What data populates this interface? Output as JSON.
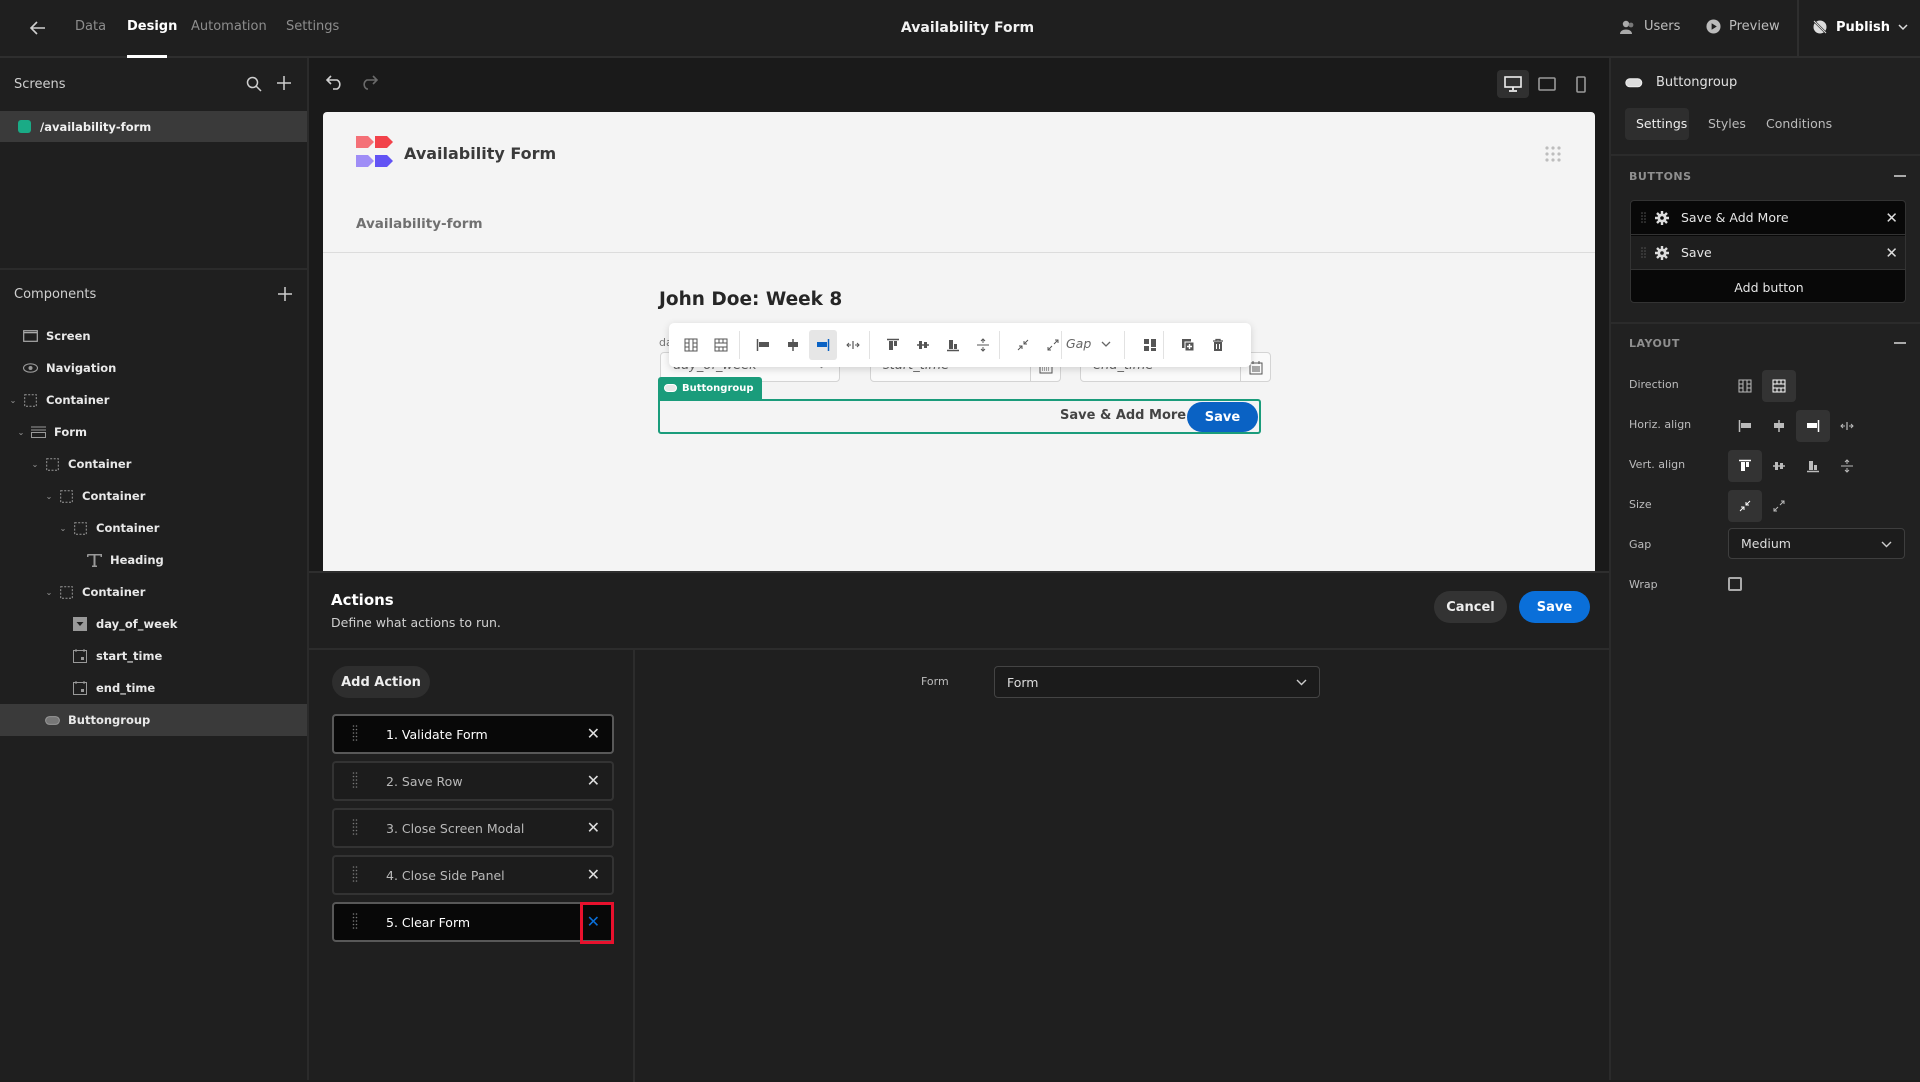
{
  "topbar": {
    "back_icon": "arrow-left-icon",
    "tabs": [
      {
        "label": "Data",
        "active": false
      },
      {
        "label": "Design",
        "active": true
      },
      {
        "label": "Automation",
        "active": false
      },
      {
        "label": "Settings",
        "active": false
      }
    ],
    "app_title": "Availability Form",
    "users_label": "Users",
    "preview_label": "Preview",
    "publish_label": "Publish"
  },
  "sidebar": {
    "screens_title": "Screens",
    "screens": [
      {
        "route": "/availability-form",
        "color": "#1aab86",
        "selected": true
      }
    ],
    "components_title": "Components",
    "tree": [
      {
        "label": "Screen",
        "icon": "screen-icon",
        "depth": 0,
        "expandable": false
      },
      {
        "label": "Navigation",
        "icon": "eye-icon",
        "depth": 0,
        "expandable": false
      },
      {
        "label": "Container",
        "icon": "container-icon",
        "depth": 0,
        "expandable": true
      },
      {
        "label": "Form",
        "icon": "form-icon",
        "depth": 1,
        "expandable": true
      },
      {
        "label": "Container",
        "icon": "container-icon",
        "depth": 2,
        "expandable": true
      },
      {
        "label": "Container",
        "icon": "container-icon",
        "depth": 3,
        "expandable": true
      },
      {
        "label": "Container",
        "icon": "container-icon",
        "depth": 4,
        "expandable": true
      },
      {
        "label": "Heading",
        "icon": "heading-icon",
        "depth": 5,
        "expandable": false
      },
      {
        "label": "Container",
        "icon": "container-icon",
        "depth": 3,
        "expandable": true
      },
      {
        "label": "day_of_week",
        "icon": "dropdown-icon",
        "depth": 4,
        "expandable": false
      },
      {
        "label": "start_time",
        "icon": "calendar-icon",
        "depth": 4,
        "expandable": false
      },
      {
        "label": "end_time",
        "icon": "calendar-icon",
        "depth": 4,
        "expandable": false
      },
      {
        "label": "Buttongroup",
        "icon": "buttongroup-icon",
        "depth": 2,
        "expandable": false,
        "selected": true
      }
    ]
  },
  "canvas": {
    "device_modes": [
      "desktop",
      "tablet",
      "mobile"
    ],
    "active_device": "desktop",
    "preview": {
      "app_name": "Availability Form",
      "nav_link": "Availability-form",
      "heading": "John Doe: Week 8",
      "field_label_partial": "da",
      "fields": [
        {
          "name": "day_of_week",
          "type": "select"
        },
        {
          "name": "start_time",
          "type": "datetime"
        },
        {
          "name": "end_time",
          "type": "datetime"
        }
      ],
      "selected_tag": "Buttongroup",
      "buttons": [
        {
          "label": "Save & Add More",
          "style": "secondary"
        },
        {
          "label": "Save",
          "style": "primary"
        }
      ]
    },
    "toolbar": {
      "gap_label": "Gap"
    }
  },
  "rightpanel": {
    "component_name": "Buttongroup",
    "tabs": [
      {
        "label": "Settings",
        "active": true
      },
      {
        "label": "Styles",
        "active": false
      },
      {
        "label": "Conditions",
        "active": false
      }
    ],
    "buttons_section": {
      "title": "BUTTONS",
      "items": [
        {
          "label": "Save & Add More"
        },
        {
          "label": "Save"
        }
      ],
      "add_label": "Add button"
    },
    "layout_section": {
      "title": "LAYOUT",
      "direction_label": "Direction",
      "direction_value": "column",
      "horiz_label": "Horiz. align",
      "horiz_value": "right",
      "vert_label": "Vert. align",
      "vert_value": "top",
      "size_label": "Size",
      "size_value": "shrink",
      "gap_label": "Gap",
      "gap_value": "Medium",
      "wrap_label": "Wrap",
      "wrap_checked": false
    }
  },
  "actions": {
    "title": "Actions",
    "subtitle": "Define what actions to run.",
    "cancel_label": "Cancel",
    "save_label": "Save",
    "add_action_label": "Add Action",
    "items": [
      {
        "label": "1. Validate Form",
        "active": true
      },
      {
        "label": "2. Save Row",
        "active": false
      },
      {
        "label": "3. Close Screen Modal",
        "active": false
      },
      {
        "label": "4. Close Side Panel",
        "active": false
      },
      {
        "label": "5. Clear Form",
        "active": true,
        "highlighted_remove": true
      }
    ],
    "settings": {
      "form_label": "Form",
      "form_value": "Form"
    }
  },
  "colors": {
    "accent_blue": "#0a6fd9",
    "selection_green": "#1a9c7b",
    "highlight_red": "#e8112d"
  }
}
